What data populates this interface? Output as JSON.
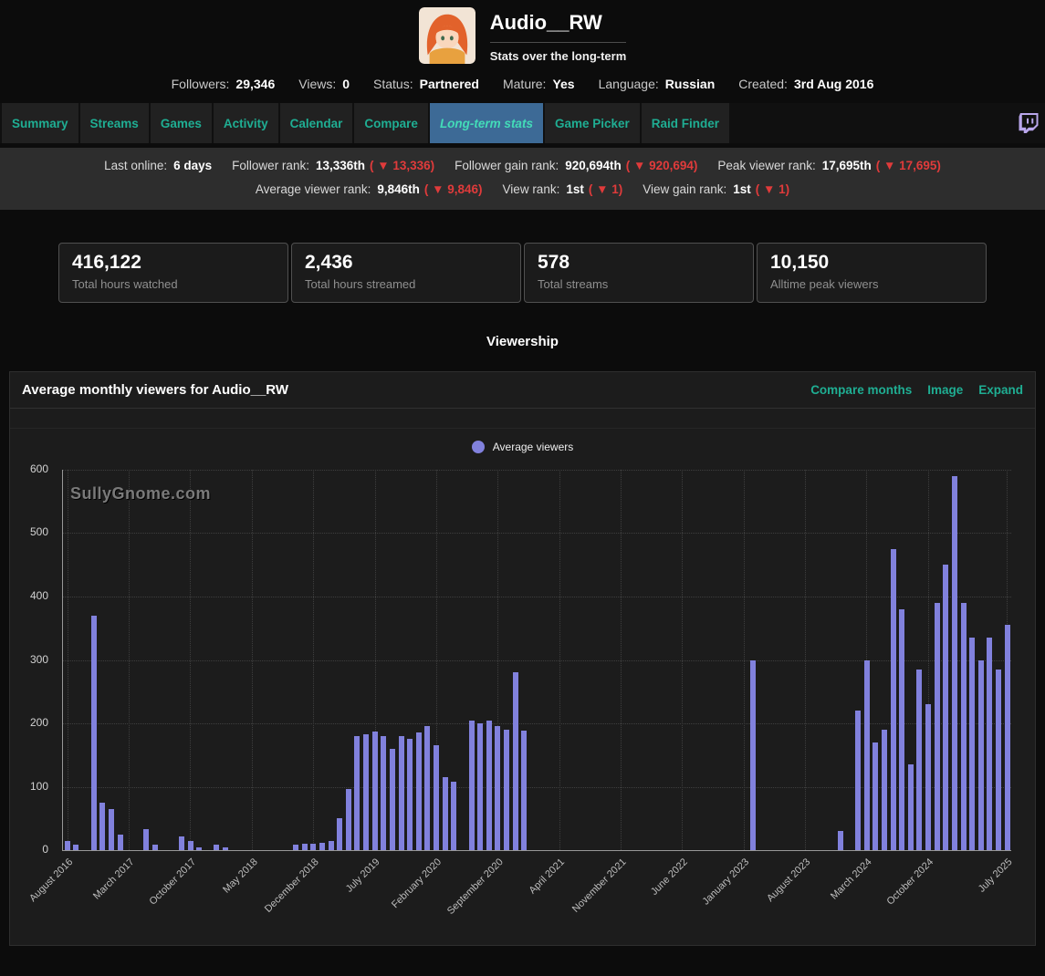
{
  "header": {
    "title": "Audio__RW",
    "subtitle": "Stats over the long-term",
    "info": [
      {
        "label": "Followers:",
        "value": "29,346"
      },
      {
        "label": "Views:",
        "value": "0"
      },
      {
        "label": "Status:",
        "value": "Partnered"
      },
      {
        "label": "Mature:",
        "value": "Yes"
      },
      {
        "label": "Language:",
        "value": "Russian"
      },
      {
        "label": "Created:",
        "value": "3rd Aug 2016"
      }
    ]
  },
  "nav": {
    "tabs": [
      {
        "label": "Summary",
        "active": false
      },
      {
        "label": "Streams",
        "active": false
      },
      {
        "label": "Games",
        "active": false
      },
      {
        "label": "Activity",
        "active": false
      },
      {
        "label": "Calendar",
        "active": false
      },
      {
        "label": "Compare",
        "active": false
      },
      {
        "label": "Long-term stats",
        "active": true
      },
      {
        "label": "Game Picker",
        "active": false
      },
      {
        "label": "Raid Finder",
        "active": false
      }
    ],
    "twitch_icon": "twitch-logo"
  },
  "ranks": {
    "arrow": "▼",
    "row1": [
      {
        "label": "Last online:",
        "value": "6 days",
        "delta": ""
      },
      {
        "label": "Follower rank:",
        "value": "13,336th",
        "delta": "13,336"
      },
      {
        "label": "Follower gain rank:",
        "value": "920,694th",
        "delta": "920,694"
      },
      {
        "label": "Peak viewer rank:",
        "value": "17,695th",
        "delta": "17,695"
      }
    ],
    "row2": [
      {
        "label": "Average viewer rank:",
        "value": "9,846th",
        "delta": "9,846"
      },
      {
        "label": "View rank:",
        "value": "1st",
        "delta": "1"
      },
      {
        "label": "View gain rank:",
        "value": "1st",
        "delta": "1"
      }
    ]
  },
  "stat_cards": [
    {
      "value": "416,122",
      "label": "Total hours watched"
    },
    {
      "value": "2,436",
      "label": "Total hours streamed"
    },
    {
      "value": "578",
      "label": "Total streams"
    },
    {
      "value": "10,150",
      "label": "Alltime peak viewers"
    }
  ],
  "section_title": "Viewership",
  "chart_panel": {
    "title": "Average monthly viewers for Audio__RW",
    "links": [
      "Compare months",
      "Image",
      "Expand"
    ],
    "legend": "Average viewers",
    "watermark": "SullyGnome.com"
  },
  "chart_data": {
    "type": "bar",
    "title": "Average monthly viewers for Audio__RW",
    "series_name": "Average viewers",
    "bar_color": "#8181dd",
    "ylim": [
      0,
      600
    ],
    "yticks": [
      0,
      100,
      200,
      300,
      400,
      500,
      600
    ],
    "x_unit": "month",
    "x_range": "August 2016 to July 2025",
    "tick_labels": [
      "August 2016",
      "March 2017",
      "October 2017",
      "May 2018",
      "December 2018",
      "July 2019",
      "February 2020",
      "September 2020",
      "April 2021",
      "November 2021",
      "June 2022",
      "January 2023",
      "August 2023",
      "March 2024",
      "October 2024",
      "July 2025"
    ],
    "tick_indices": [
      0,
      7,
      14,
      21,
      28,
      35,
      42,
      49,
      56,
      63,
      70,
      77,
      84,
      91,
      98,
      107
    ],
    "values": [
      15,
      8,
      0,
      370,
      75,
      65,
      25,
      0,
      0,
      33,
      8,
      0,
      0,
      22,
      15,
      5,
      0,
      8,
      5,
      0,
      0,
      0,
      0,
      0,
      0,
      0,
      8,
      10,
      10,
      12,
      15,
      50,
      97,
      180,
      183,
      187,
      180,
      160,
      180,
      175,
      185,
      195,
      165,
      115,
      108,
      0,
      205,
      200,
      205,
      195,
      190,
      280,
      188,
      0,
      0,
      0,
      0,
      0,
      0,
      0,
      0,
      0,
      0,
      0,
      0,
      0,
      0,
      0,
      0,
      0,
      0,
      0,
      0,
      0,
      0,
      0,
      0,
      0,
      300,
      0,
      0,
      0,
      0,
      0,
      0,
      0,
      0,
      0,
      30,
      0,
      220,
      300,
      170,
      190,
      475,
      380,
      135,
      285,
      230,
      390,
      450,
      590,
      390,
      335,
      300,
      335,
      285,
      355
    ]
  },
  "colors": {
    "accent_teal": "#1fae93",
    "active_tab_bg": "#3d6a96",
    "bar_purple": "#8181dd",
    "delta_red": "#e03b3b",
    "twitch_purple": "#9146ff"
  }
}
